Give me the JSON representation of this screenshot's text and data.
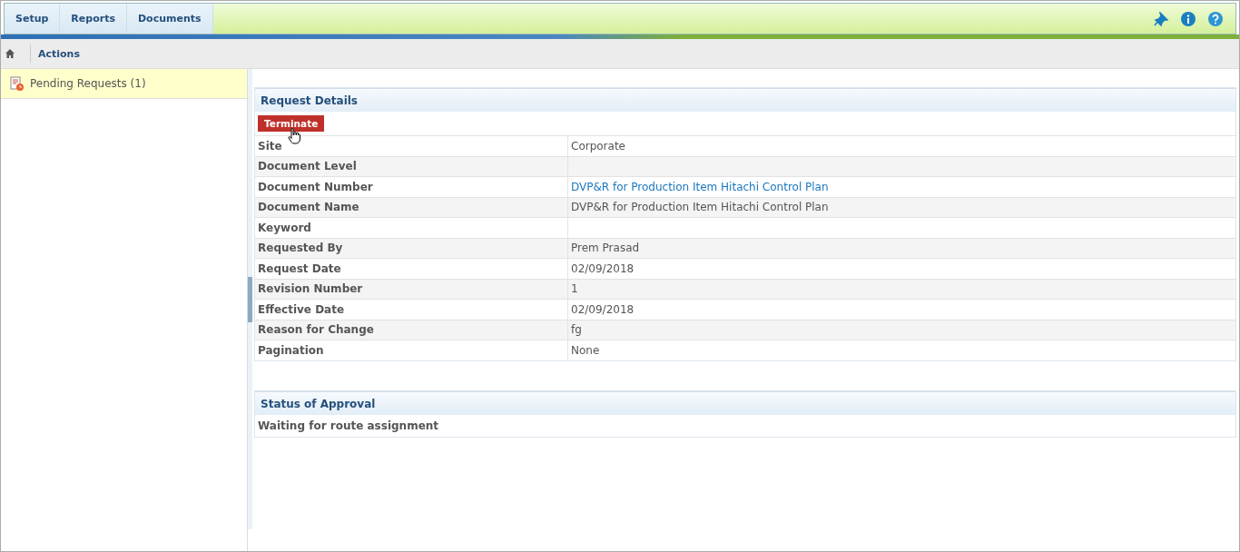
{
  "menu": [
    {
      "label": "Setup"
    },
    {
      "label": "Reports"
    },
    {
      "label": "Documents"
    }
  ],
  "breadcrumb": {
    "current": "Actions"
  },
  "sidebar": {
    "items": [
      {
        "label": "Pending Requests (1)",
        "selected": true
      }
    ]
  },
  "request_details": {
    "title": "Request Details",
    "button": "Terminate",
    "rows": [
      {
        "label": "Site",
        "value": "Corporate",
        "kind": "text"
      },
      {
        "label": "Document Level",
        "kind": "text"
      },
      {
        "label": "Document Number",
        "value": "DVP&R for Production Item Hitachi Control Plan",
        "kind": "link"
      },
      {
        "label": "Document Name",
        "value": "DVP&R for Production Item Hitachi Control Plan",
        "kind": "text"
      },
      {
        "label": "Keyword",
        "kind": "text"
      },
      {
        "label": "Requested By",
        "value": "Prem Prasad",
        "kind": "text"
      },
      {
        "label": "Request Date",
        "value": "02/09/2018",
        "kind": "text"
      },
      {
        "label": "Revision Number",
        "value": "1",
        "kind": "text"
      },
      {
        "label": "Effective Date",
        "value": "02/09/2018",
        "kind": "text"
      },
      {
        "label": "Reason for Change",
        "value": "fg",
        "kind": "text"
      },
      {
        "label": "Pagination",
        "value": "None",
        "kind": "text"
      }
    ]
  },
  "status_of_approval": {
    "title": "Status of Approval",
    "message": "Waiting for route assignment"
  }
}
